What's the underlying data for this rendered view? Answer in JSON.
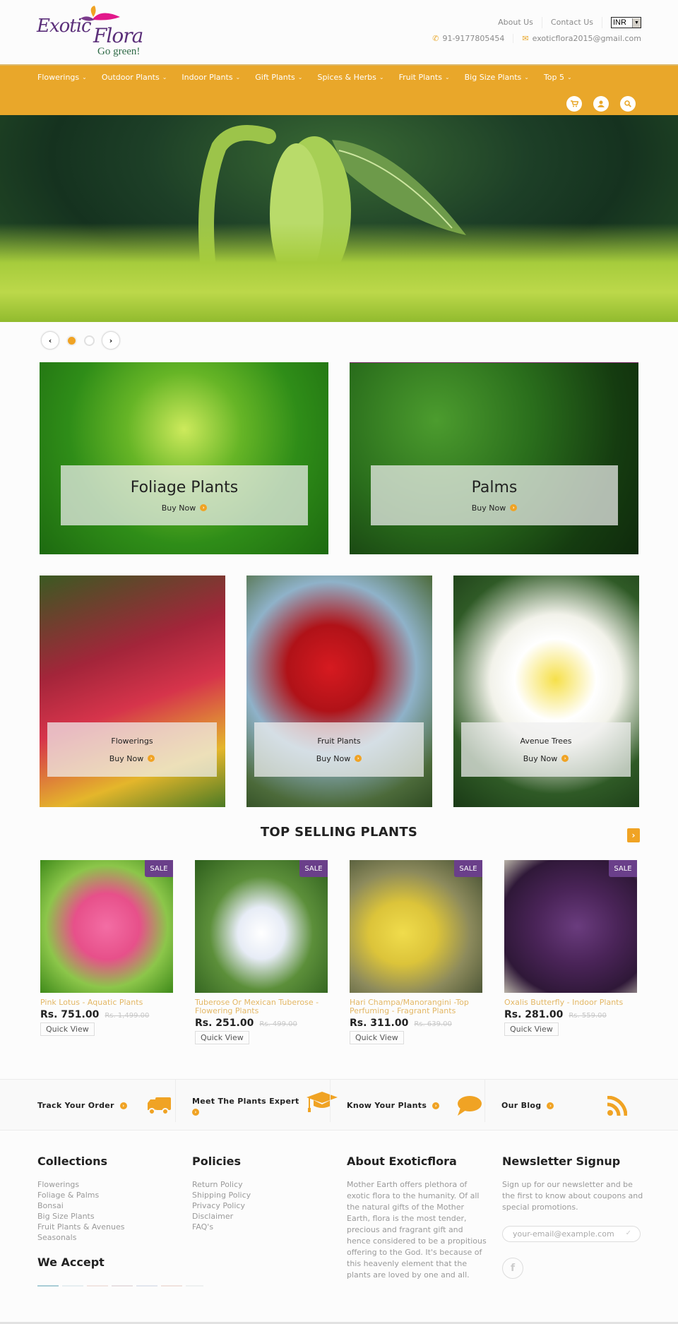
{
  "header": {
    "logo": {
      "brand": "Exotic Flora",
      "word1": "Exotic",
      "word2": "Flora",
      "tagline": "Go green!"
    },
    "links": [
      "About Us",
      "Contact Us"
    ],
    "currency": {
      "selected": "INR"
    },
    "phone": "91-9177805454",
    "email": "exoticflora2015@gmail.com"
  },
  "nav": {
    "items": [
      {
        "label": "Flowerings"
      },
      {
        "label": "Outdoor Plants"
      },
      {
        "label": "Indoor Plants"
      },
      {
        "label": "Gift Plants"
      },
      {
        "label": "Spices & Herbs"
      },
      {
        "label": "Fruit Plants"
      },
      {
        "label": "Big Size Plants"
      },
      {
        "label": "Top 5"
      }
    ],
    "icons": [
      "cart-icon",
      "user-icon",
      "search-icon"
    ]
  },
  "slider": {
    "total_slides": 2,
    "active_slide": 1
  },
  "banners": {
    "large": [
      {
        "title": "Foliage Plants",
        "cta": "Buy Now"
      },
      {
        "title": "Palms",
        "cta": "Buy Now"
      }
    ],
    "small": [
      {
        "title": "Flowerings",
        "cta": "Buy Now"
      },
      {
        "title": "Fruit Plants",
        "cta": "Buy Now"
      },
      {
        "title": "Avenue Trees",
        "cta": "Buy Now"
      }
    ]
  },
  "top_selling": {
    "title": "TOP SELLING PLANTS",
    "products": [
      {
        "badge": "SALE",
        "name": "Pink Lotus - Aquatic Plants",
        "price": "Rs. 751.00",
        "old_price": "Rs. 1,499.00",
        "action": "Quick View"
      },
      {
        "badge": "SALE",
        "name": "Tuberose Or Mexican Tuberose - Flowering Plants",
        "price": "Rs. 251.00",
        "old_price": "Rs. 499.00",
        "action": "Quick View"
      },
      {
        "badge": "SALE",
        "name": "Hari Champa/Manorangini -Top Perfuming - Fragrant Plants",
        "price": "Rs. 311.00",
        "old_price": "Rs. 639.00",
        "action": "Quick View"
      },
      {
        "badge": "SALE",
        "name": "Oxalis Butterfly - Indoor Plants",
        "price": "Rs. 281.00",
        "old_price": "Rs. 559.00",
        "action": "Quick View"
      }
    ]
  },
  "features": [
    {
      "label": "Track Your Order",
      "icon": "truck-icon"
    },
    {
      "label": "Meet The Plants Expert",
      "icon": "graduation-cap-icon"
    },
    {
      "label": "Know Your Plants",
      "icon": "speech-bubble-icon"
    },
    {
      "label": "Our Blog",
      "icon": "rss-icon"
    }
  ],
  "footer": {
    "collections": {
      "title": "Collections",
      "links": [
        "Flowerings",
        "Foliage & Palms",
        "Bonsai",
        "Big Size Plants",
        "Fruit Plants & Avenues",
        "Seasonals"
      ]
    },
    "policies": {
      "title": "Policies",
      "links": [
        "Return Policy",
        "Shipping Policy",
        "Privacy Policy",
        "Disclaimer",
        "FAQ's"
      ]
    },
    "about": {
      "title": "About Exoticflora",
      "text": "Mother Earth offers plethora of exotic flora to the humanity. Of all the natural gifts of the Mother Earth, flora is the most tender, precious and fragrant gift and hence considered to be a propitious offering to the God. It's because of this heavenly element that the plants are loved by one and all."
    },
    "newsletter": {
      "title": "Newsletter Signup",
      "text": "Sign up for our newsletter and be the first to know about coupons and special promotions.",
      "placeholder": "your-email@example.com",
      "social": [
        "facebook-icon"
      ]
    },
    "we_accept": {
      "title": "We Accept"
    }
  },
  "colors": {
    "accent": "#e9a72a",
    "sale_badge": "#6a3f8a",
    "product_name": "#e3b765"
  }
}
